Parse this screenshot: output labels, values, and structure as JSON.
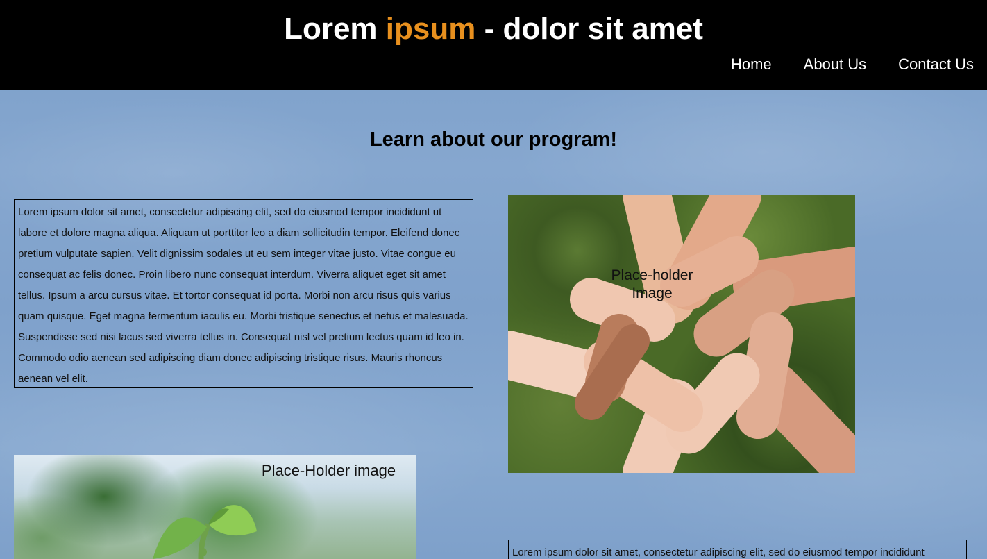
{
  "header": {
    "title_part1": "Lorem ",
    "title_accent": "ipsum",
    "title_part2": " - dolor sit amet",
    "accent_color": "#e8901e",
    "background_color": "#000000"
  },
  "nav": {
    "items": [
      {
        "label": "Home"
      },
      {
        "label": "About Us"
      },
      {
        "label": "Contact Us"
      }
    ]
  },
  "main": {
    "heading": "Learn about our program!",
    "text_block_1": "Lorem ipsum dolor sit amet, consectetur adipiscing elit, sed do eiusmod tempor incididunt ut labore et dolore magna aliqua. Aliquam ut porttitor leo a diam sollicitudin tempor. Eleifend donec pretium vulputate sapien. Velit dignissim sodales ut eu sem integer vitae justo. Vitae congue eu consequat ac felis donec. Proin libero nunc consequat interdum. Viverra aliquet eget sit amet tellus. Ipsum a arcu cursus vitae. Et tortor consequat id porta. Morbi non arcu risus quis varius quam quisque. Eget magna fermentum iaculis eu. Morbi tristique senectus et netus et malesuada. Suspendisse sed nisi lacus sed viverra tellus in. Consequat nisl vel pretium lectus quam id leo in. Commodo odio aenean sed adipiscing diam donec adipiscing tristique risus. Mauris rhoncus aenean vel elit.",
    "image_1_label": "Place-holder Image",
    "image_2_label": "Place-Holder image",
    "text_block_2": "Lorem ipsum dolor sit amet, consectetur adipiscing elit, sed do eiusmod tempor incididunt"
  }
}
